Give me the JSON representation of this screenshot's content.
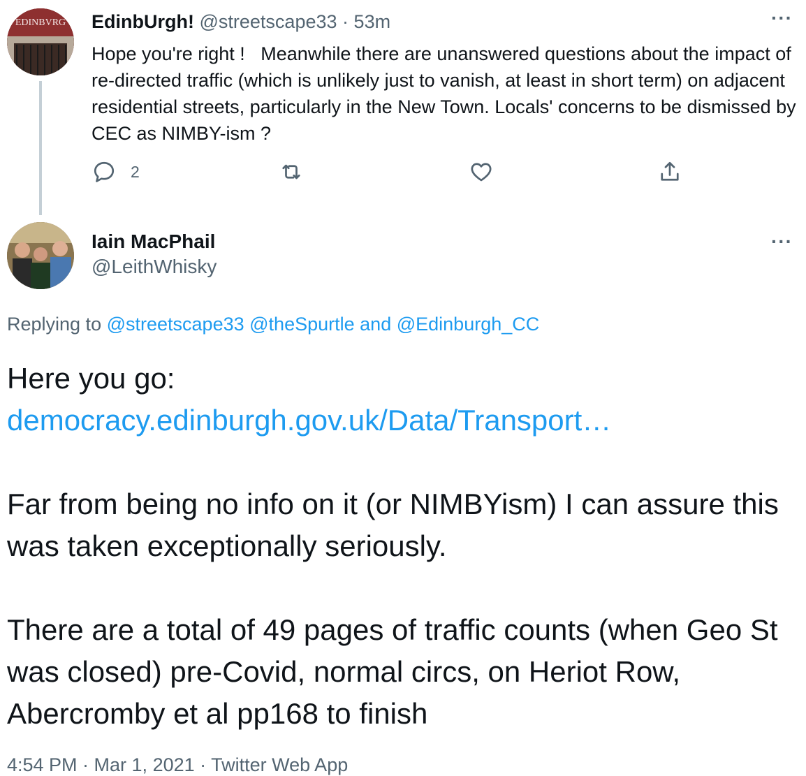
{
  "parent_tweet": {
    "display_name": "EdinbUrgh!",
    "handle": "@streetscape33",
    "separator": "·",
    "time": "53m",
    "avatar_text": "EDINBVRG",
    "text": "Hope you're right !   Meanwhile there are unanswered questions about the impact of re-directed traffic (which is unlikely just to vanish, at least in short term) on adjacent residential streets, particularly in the New Town. Locals' concerns to be dismissed by CEC as NIMBY-ism ?",
    "reply_count": "2",
    "more_label": "···"
  },
  "main_tweet": {
    "display_name": "Iain MacPhail",
    "handle": "@LeithWhisky",
    "more_label": "···",
    "replying_label": "Replying to",
    "mention_1": "@streetscape33",
    "mention_2": "@theSpurtle",
    "and_label": "and",
    "mention_3": "@Edinburgh_CC",
    "line_1": "Here you go:",
    "link": "democracy.edinburgh.gov.uk/Data/Transport…",
    "para_2": "Far from being no info on it (or NIMBYism) I can assure this was taken exceptionally seriously.",
    "para_3": "There are a total of 49 pages of traffic counts (when Geo St was closed) pre-Covid, normal circs, on Heriot Row, Abercromby et al pp168 to finish",
    "meta": "4:54 PM · Mar 1, 2021 · Twitter Web App"
  },
  "colors": {
    "accent": "#1d9bf0",
    "secondary_text": "#536471",
    "thread_line": "#c4cfd6"
  },
  "icons": [
    "reply-icon",
    "retweet-icon",
    "like-icon",
    "share-icon",
    "more-icon"
  ]
}
